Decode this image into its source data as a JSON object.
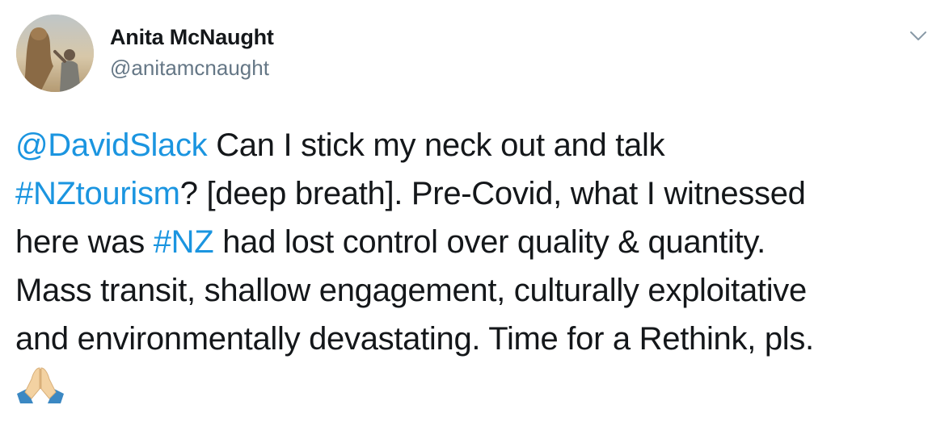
{
  "author": {
    "display_name": "Anita McNaught",
    "handle": "@anitamcnaught"
  },
  "menu": {
    "icon": "chevron-down-icon"
  },
  "tweet": {
    "line1_mention": "@DavidSlack",
    "line1_rest": " Can I stick my neck out and talk",
    "line2_hashtag": "#NZtourism",
    "line2_rest": "? [deep breath]. Pre-Covid, what I witnessed",
    "line3_start": "here was ",
    "line3_hashtag": "#NZ",
    "line3_rest": " had lost control over quality & quantity.",
    "line4": "Mass transit, shallow engagement, culturally exploitative",
    "line5": "and environmentally devastating. Time for a Rethink, pls.",
    "emoji": "folded-hands-emoji"
  },
  "colors": {
    "link": "#1b95e0",
    "text": "#14171a",
    "secondary": "#657786"
  }
}
